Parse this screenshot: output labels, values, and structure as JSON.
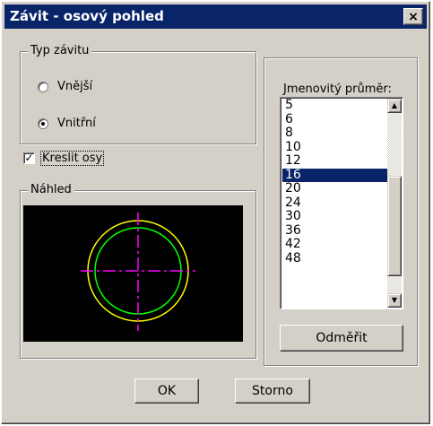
{
  "window": {
    "title": "Závit - osový pohled",
    "close_glyph": "×"
  },
  "thread_type": {
    "label": "Typ závitu",
    "options": [
      {
        "label": "Vnější",
        "selected": false
      },
      {
        "label": "Vnitřní",
        "selected": true
      }
    ]
  },
  "draw_axes": {
    "label": "Kreslit osy",
    "checked": true,
    "check_glyph": "✓"
  },
  "preview": {
    "label": "Náhled",
    "colors": {
      "outer": "#ffff00",
      "inner": "#00ff00",
      "axes": "#ff00ff",
      "background": "#000000"
    }
  },
  "diameter_list": {
    "label": "Jmenovitý průměr:",
    "items": [
      "5",
      "6",
      "8",
      "10",
      "12",
      "16",
      "20",
      "24",
      "30",
      "36",
      "42",
      "48"
    ],
    "selected": "16"
  },
  "buttons": {
    "measure": "Odměřit",
    "ok": "OK",
    "cancel": "Storno"
  }
}
